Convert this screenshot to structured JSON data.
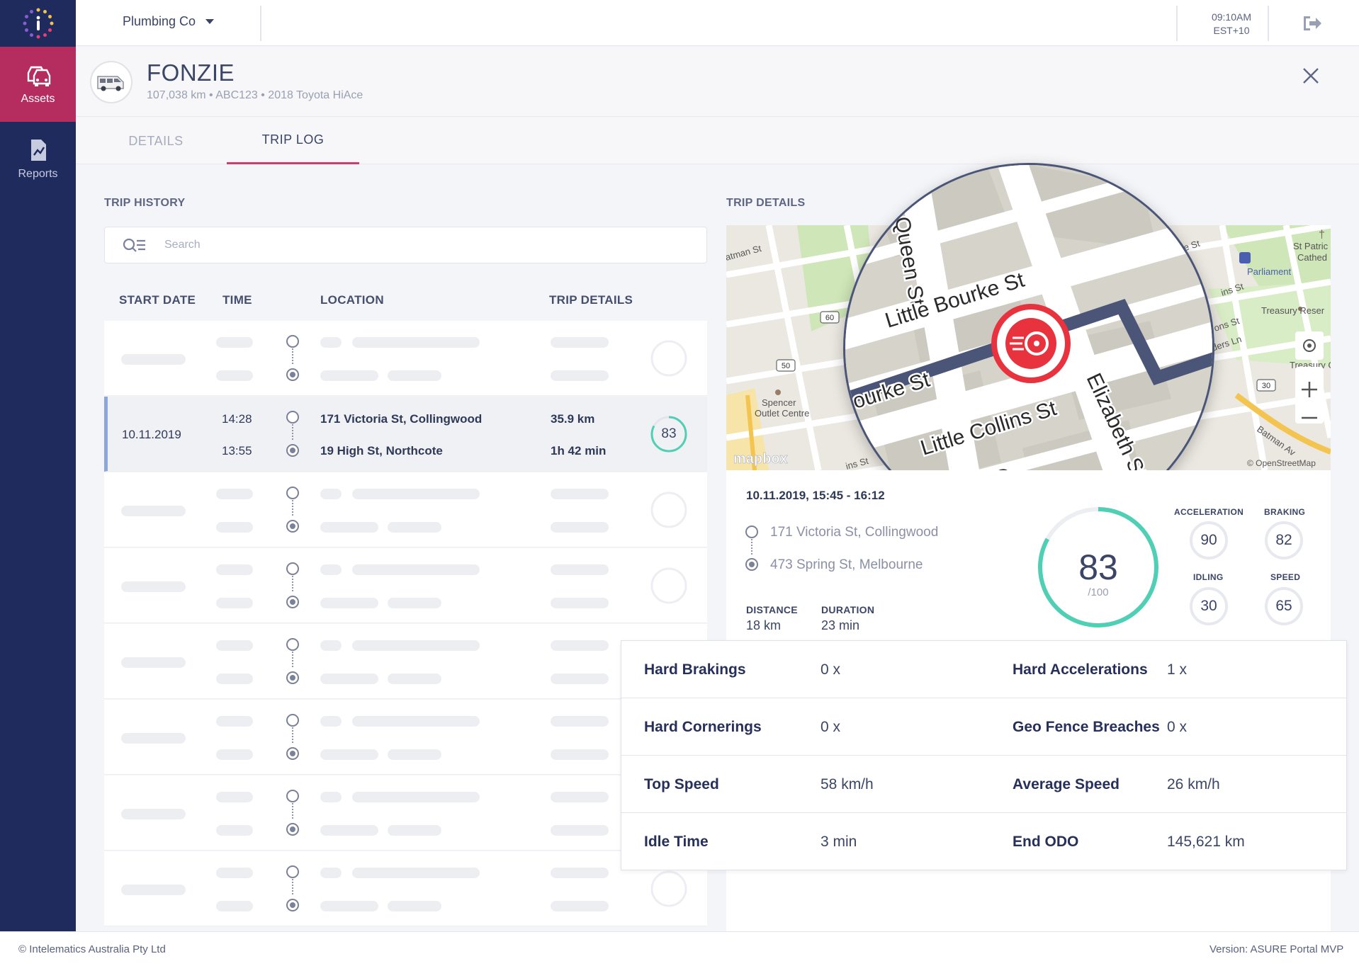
{
  "sidebar": {
    "items": [
      {
        "label": "Assets",
        "icon": "car-icon",
        "active": true
      },
      {
        "label": "Reports",
        "icon": "report-icon",
        "active": false
      }
    ]
  },
  "topbar": {
    "company": "Plumbing Co",
    "time": "09:10AM",
    "timezone": "EST+10"
  },
  "asset": {
    "name": "FONZIE",
    "meta": "107,038 km • ABC123 • 2018 Toyota HiAce"
  },
  "tabs": [
    {
      "label": "DETAILS",
      "active": false
    },
    {
      "label": "TRIP LOG",
      "active": true
    }
  ],
  "trip_history": {
    "title": "TRIP HISTORY",
    "search_placeholder": "Search",
    "columns": [
      "START DATE",
      "TIME",
      "LOCATION",
      "TRIP DETAILS"
    ],
    "selected": {
      "date": "10.11.2019",
      "start_time": "14:28",
      "end_time": "13:55",
      "from": "171 Victoria St, Collingwood",
      "to": "19 High St, Northcote",
      "distance": "35.9 km",
      "duration": "1h 42 min",
      "score": "83"
    }
  },
  "trip_details": {
    "title": "TRIP DETAILS",
    "datetime": "10.11.2019, 15:45 - 16:12",
    "from": "171 Victoria St, Collingwood",
    "to": "473 Spring St, Melbourne",
    "distance_label": "DISTANCE",
    "distance": "18 km",
    "duration_label": "DURATION",
    "duration": "23 min",
    "score": "83",
    "score_max": "/100",
    "metrics": [
      {
        "label": "ACCELERATION",
        "value": "90"
      },
      {
        "label": "BRAKING",
        "value": "82"
      },
      {
        "label": "IDLING",
        "value": "30"
      },
      {
        "label": "SPEED",
        "value": "65"
      }
    ],
    "stats": [
      {
        "k1": "Hard Brakings",
        "v1": "0 x",
        "k2": "Hard Accelerations",
        "v2": "1 x"
      },
      {
        "k1": "Hard Cornerings",
        "v1": "0 x",
        "k2": "Geo Fence Breaches",
        "v2": "0 x"
      },
      {
        "k1": "Top Speed",
        "v1": "58 km/h",
        "k2": "Average Speed",
        "v2": "26 km/h"
      },
      {
        "k1": "Idle Time",
        "v1": "3 min",
        "k2": "End ODO",
        "v2": "145,621 km"
      }
    ]
  },
  "map": {
    "streets_lens": [
      "Queen St",
      "Little Bourke St",
      "Bourke St",
      "Little Collins St",
      "Elizabeth St",
      "Queen St"
    ],
    "streets_small": [
      "atman St",
      "St",
      "urke St",
      "St Patric",
      "Cathed",
      "Parliament",
      "ins St",
      "Treasury Reser",
      "ons St",
      "Treasury Gar",
      "nders Ln",
      "Batman Av",
      "Spencer",
      "Outlet Centre",
      "ins St"
    ],
    "road_numbers": [
      "60",
      "50",
      "30"
    ],
    "attribution": "© OpenStreetMap",
    "logo": "mapbox"
  },
  "footer": {
    "copyright": "© Intelematics Australia Pty Ltd",
    "version": "Version: ASURE Portal MVP"
  },
  "colors": {
    "sidebar": "#1f2b5d",
    "active_nav": "#b52d5e",
    "tab_underline": "#d53a6a",
    "score_ring": "#4fcfb3",
    "route": "#4a5578",
    "event_marker": "#e8333e"
  }
}
